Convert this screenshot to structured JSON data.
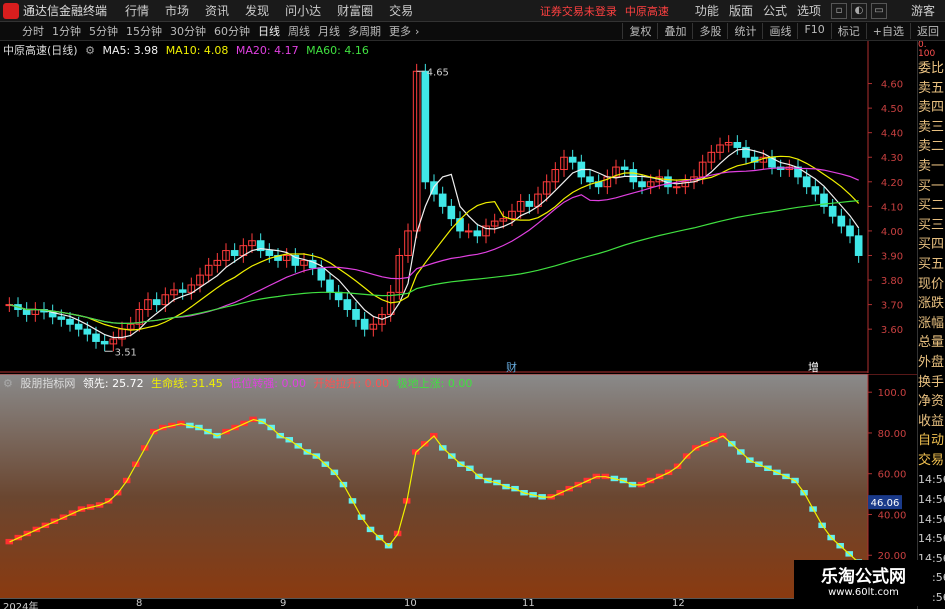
{
  "menubar": {
    "app_title": "通达信金融终端",
    "items": [
      "行情",
      "市场",
      "资讯",
      "发现",
      "问小达",
      "财富圈",
      "交易"
    ],
    "warning": "证券交易未登录",
    "stock_name": "中原高速",
    "right_items": [
      "功能",
      "版面",
      "公式",
      "选项"
    ],
    "guest": "游客"
  },
  "toolbar": {
    "periods": [
      "分时",
      "1分钟",
      "5分钟",
      "15分钟",
      "30分钟",
      "60分钟",
      "日线",
      "周线",
      "月线",
      "多周期",
      "更多"
    ],
    "active": "日线",
    "right": [
      "复权",
      "叠加",
      "多股",
      "统计",
      "画线",
      "F10",
      "标记",
      "+自选",
      "返回"
    ]
  },
  "main_chart": {
    "title": "中原高速(日线)",
    "ma": [
      {
        "label": "MA5: 3.98",
        "color": "#f0f0f0"
      },
      {
        "label": "MA10: 4.08",
        "color": "#f0f000"
      },
      {
        "label": "MA20: 4.17",
        "color": "#e040e0"
      },
      {
        "label": "MA60: 4.16",
        "color": "#40e040"
      }
    ],
    "high_label": "4.65",
    "low_label": "3.51",
    "badge1": "财",
    "badge2": "增"
  },
  "indicator": {
    "name": "股朋指标网",
    "items": [
      {
        "label": "领先: 25.72",
        "color": "#ffffff"
      },
      {
        "label": "生命线: 31.45",
        "color": "#f0f000"
      },
      {
        "label": "低位转强: 0.00",
        "color": "#e040e0"
      },
      {
        "label": "开始拉升: 0.00",
        "color": "#ff5050"
      },
      {
        "label": "极地上涨: 0.00",
        "color": "#40e040"
      }
    ],
    "current": "46.06"
  },
  "right_panel": [
    "委比",
    "卖五",
    "卖四",
    "卖三",
    "卖二",
    "卖一",
    "买一",
    "买二",
    "买三",
    "买四",
    "买五",
    "现价",
    "涨跌",
    "涨幅",
    "总量",
    "外盘",
    "换手",
    "净资",
    "收益",
    "自动",
    "交易",
    "14:56",
    "14:56",
    "14:56",
    "14:56",
    "14:56",
    "14:56",
    "14:56"
  ],
  "right_panel_top": [
    "0.",
    "100"
  ],
  "chart_data": [
    {
      "type": "candlestick",
      "title": "中原高速(日线)",
      "y_ticks": [
        3.6,
        3.7,
        3.8,
        3.9,
        4.0,
        4.1,
        4.2,
        4.3,
        4.4,
        4.5,
        4.6
      ],
      "ylim": [
        3.45,
        4.7
      ],
      "close": [
        3.7,
        3.68,
        3.66,
        3.68,
        3.67,
        3.65,
        3.64,
        3.62,
        3.6,
        3.58,
        3.55,
        3.54,
        3.56,
        3.6,
        3.62,
        3.68,
        3.72,
        3.7,
        3.74,
        3.76,
        3.75,
        3.78,
        3.82,
        3.86,
        3.88,
        3.92,
        3.9,
        3.94,
        3.96,
        3.92,
        3.9,
        3.88,
        3.9,
        3.86,
        3.88,
        3.85,
        3.8,
        3.75,
        3.72,
        3.68,
        3.64,
        3.6,
        3.62,
        3.66,
        3.75,
        3.9,
        4.0,
        4.65,
        4.2,
        4.15,
        4.1,
        4.05,
        4.0,
        4.0,
        3.98,
        4.02,
        4.04,
        4.05,
        4.08,
        4.12,
        4.1,
        4.15,
        4.2,
        4.25,
        4.3,
        4.28,
        4.22,
        4.2,
        4.18,
        4.22,
        4.26,
        4.25,
        4.2,
        4.18,
        4.2,
        4.22,
        4.18,
        4.18,
        4.2,
        4.22,
        4.28,
        4.32,
        4.35,
        4.36,
        4.34,
        4.3,
        4.28,
        4.3,
        4.26,
        4.25,
        4.26,
        4.22,
        4.18,
        4.15,
        4.1,
        4.06,
        4.02,
        3.98,
        3.9
      ],
      "ma5": 3.98,
      "ma10": 4.08,
      "ma20": 4.17,
      "ma60": 4.16
    },
    {
      "type": "bar",
      "title": "股朋指标网",
      "y_ticks": [
        20.0,
        40.0,
        60.0,
        80.0,
        100.0
      ],
      "ylim": [
        0,
        105
      ],
      "values": [
        28,
        30,
        32,
        34,
        36,
        38,
        40,
        42,
        44,
        45,
        46,
        48,
        52,
        58,
        66,
        74,
        82,
        84,
        85,
        86,
        85,
        84,
        82,
        80,
        82,
        84,
        86,
        88,
        87,
        84,
        80,
        78,
        75,
        72,
        70,
        66,
        62,
        56,
        48,
        40,
        34,
        30,
        26,
        32,
        48,
        72,
        76,
        80,
        74,
        70,
        66,
        64,
        60,
        58,
        57,
        55,
        54,
        52,
        51,
        50,
        50,
        52,
        54,
        56,
        58,
        60,
        60,
        59,
        58,
        56,
        56,
        58,
        60,
        62,
        65,
        70,
        74,
        76,
        78,
        80,
        76,
        72,
        68,
        66,
        64,
        62,
        60,
        58,
        52,
        44,
        36,
        30,
        26,
        22,
        18
      ]
    }
  ],
  "x_labels": [
    "2024年",
    "8",
    "9",
    "10",
    "11",
    "12"
  ],
  "watermark": {
    "title": "乐淘公式网",
    "url": "www.60lt.com"
  }
}
